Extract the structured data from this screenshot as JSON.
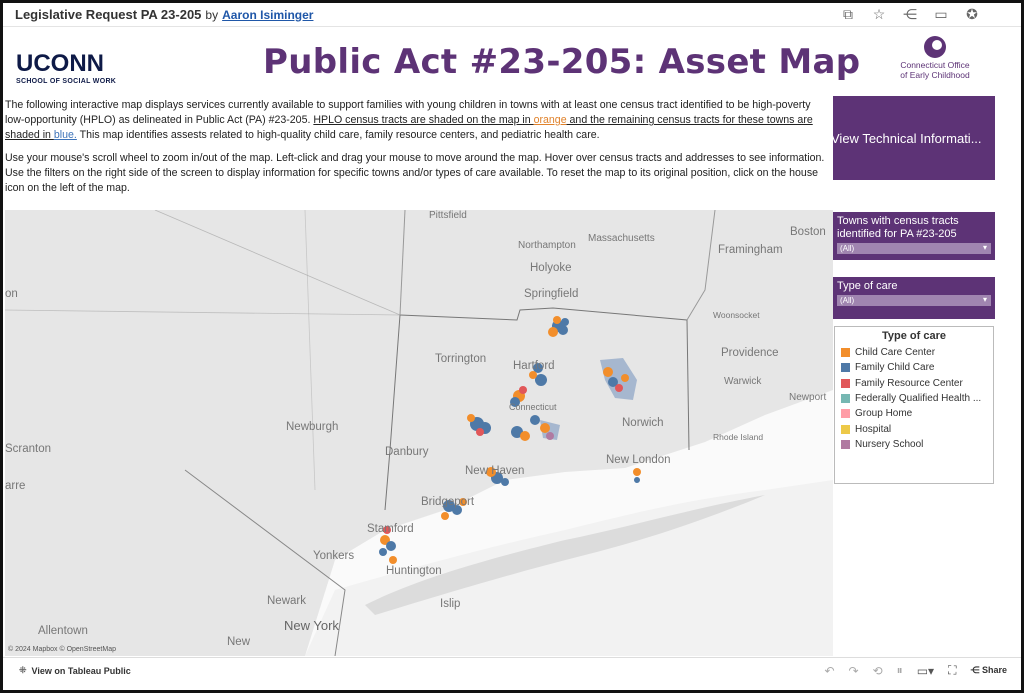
{
  "topbar": {
    "title": "Legislative Request PA 23-205",
    "by": "by",
    "author": "Aaron Isiminger"
  },
  "header": {
    "uconn_name": "UCONN",
    "uconn_sub": "SCHOOL OF SOCIAL WORK",
    "title": "Public Act #23-205: Asset Map",
    "oec_line1": "Connecticut Office",
    "oec_line2": "of Early Childhood"
  },
  "intro": {
    "p1_a": "The following interactive map displays services currently available to support families with young children in towns with at least one census tract identified to be high-poverty low-opportunity (HPLO) as delineated in Public Act (PA) #23-205. ",
    "p1_b": "HPLO census tracts are shaded on the map in ",
    "p1_orange": "orange",
    "p1_c": " and the remaining census tracts for these towns are shaded in ",
    "p1_blue": "blue.",
    "p1_d": " This map identifies assests related to high-quality child care, family resource centers, and pediatric health care.",
    "p2": "Use your mouse's scroll wheel to zoom in/out of the map. Left-click and drag your mouse to move around the map. Hover over census tracts and addresses to see information. Use the filters on the right side of the screen to display information for specific towns and/or types of care available. To reset the map to its original position, click on the house icon on the left of the map."
  },
  "tech_button": "View Technical Informati...",
  "filters": {
    "towns_label": "Towns with census tracts identified for PA #23-205",
    "towns_value": "(All)",
    "care_label": "Type of care",
    "care_value": "(All)"
  },
  "legend": {
    "title": "Type of care",
    "items": [
      {
        "label": "Child Care Center",
        "color": "#f28e2b"
      },
      {
        "label": "Family Child Care",
        "color": "#4e79a7"
      },
      {
        "label": "Family Resource Center",
        "color": "#e15759"
      },
      {
        "label": "Federally Qualified Health ...",
        "color": "#76b7b2"
      },
      {
        "label": "Group Home",
        "color": "#ff9da7"
      },
      {
        "label": "Hospital",
        "color": "#edc948"
      },
      {
        "label": "Nursery School",
        "color": "#b07aa1"
      }
    ]
  },
  "map": {
    "places": {
      "pittsfield": "Pittsfield",
      "northampton": "Northampton",
      "massachusetts": "Massachusetts",
      "framingham": "Framingham",
      "boston": "Boston",
      "holyoke": "Holyoke",
      "springfield": "Springfield",
      "woonsocket": "Woonsocket",
      "providence": "Providence",
      "warwick": "Warwick",
      "torrington": "Torrington",
      "hartford": "Hartford",
      "connecticut": "Connecticut",
      "norwich": "Norwich",
      "newport": "Newport",
      "rhode_island": "Rhode Island",
      "newburgh": "Newburgh",
      "danbury": "Danbury",
      "new_haven": "New Haven",
      "new_london": "New London",
      "scranton": "Scranton",
      "bridgeport": "Bridgeport",
      "stamford": "Stamford",
      "yonkers": "Yonkers",
      "huntington": "Huntington",
      "newark": "Newark",
      "islip": "Islip",
      "new_york": "New York",
      "allentown": "Allentown",
      "new": "New",
      "on": "on",
      "arre": "arre"
    },
    "credit": "© 2024 Mapbox © OpenStreetMap"
  },
  "footer": {
    "view_label": "View on Tableau Public",
    "share_label": "Share"
  }
}
